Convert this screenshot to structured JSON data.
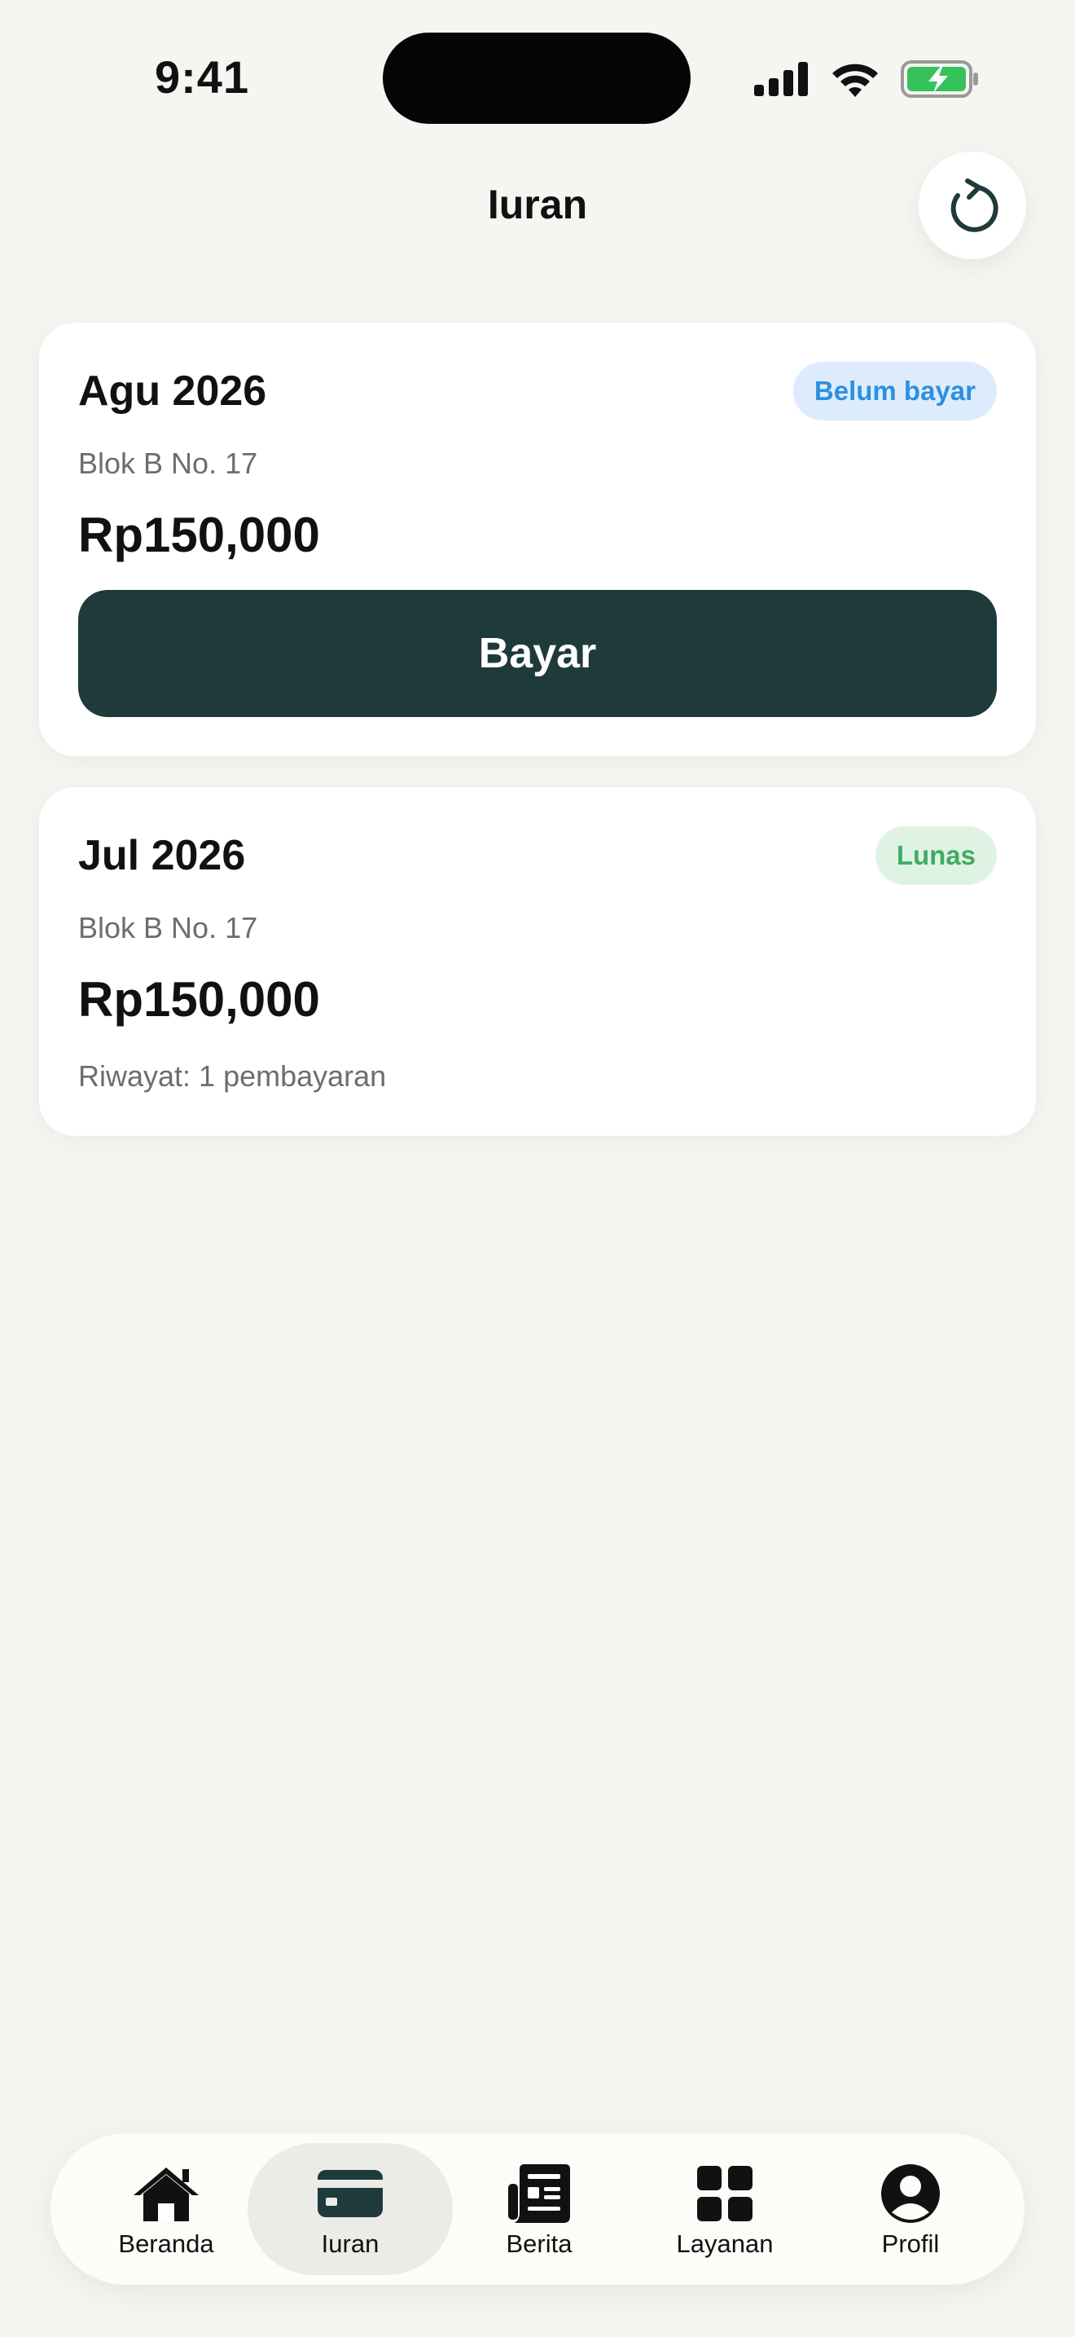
{
  "status_bar": {
    "time": "9:41"
  },
  "header": {
    "title": "Iuran",
    "refresh_icon": "refresh-icon"
  },
  "bills": [
    {
      "month": "Agu 2026",
      "address": "Blok B No. 17",
      "amount": "Rp150,000",
      "status": "Belum bayar",
      "status_color": "#2e8fe0",
      "action_label": "Bayar"
    },
    {
      "month": "Jul 2026",
      "address": "Blok B No. 17",
      "amount": "Rp150,000",
      "status": "Lunas",
      "status_color": "#3fac63",
      "history": "Riwayat: 1 pembayaran"
    }
  ],
  "tabs": [
    {
      "label": "Beranda",
      "icon": "home-icon",
      "active": false
    },
    {
      "label": "Iuran",
      "icon": "card-icon",
      "active": true
    },
    {
      "label": "Berita",
      "icon": "newspaper-icon",
      "active": false
    },
    {
      "label": "Layanan",
      "icon": "grid-icon",
      "active": false
    },
    {
      "label": "Profil",
      "icon": "profile-icon",
      "active": false
    }
  ],
  "colors": {
    "accent": "#1f3a3a",
    "background": "#f6f5f2"
  }
}
